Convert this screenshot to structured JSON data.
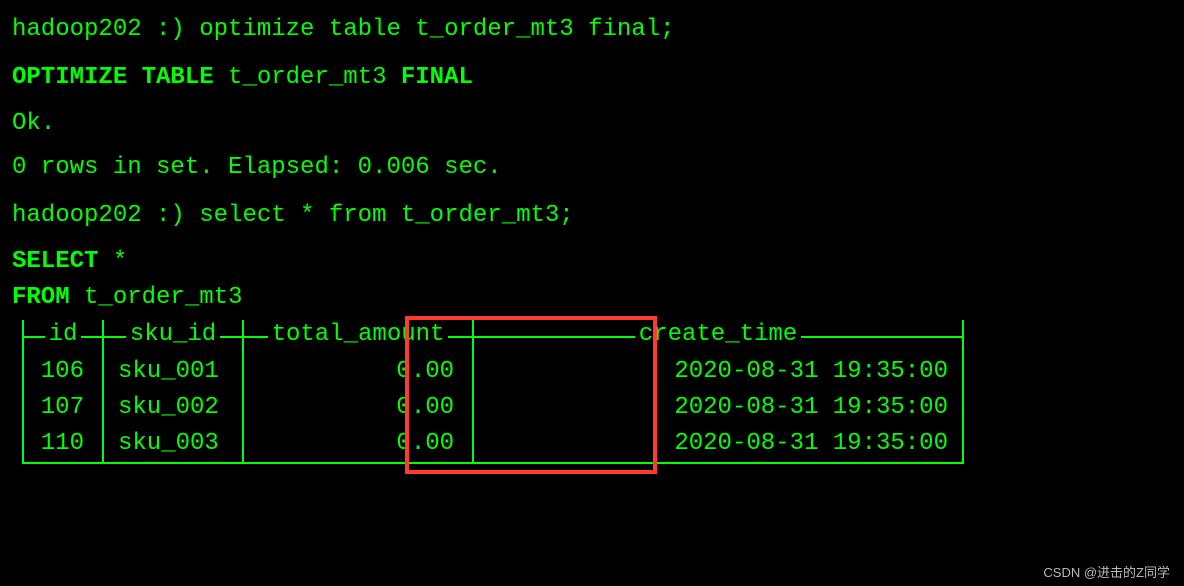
{
  "prompt1": {
    "host": "hadoop202 :)",
    "cmd": " optimize table t_order_mt3 final;"
  },
  "echo1": {
    "kw1": "OPTIMIZE TABLE",
    "tbl": " t_order_mt3 ",
    "kw2": "FINAL"
  },
  "status_ok": "Ok.",
  "elapsed": "0 rows in set. Elapsed: 0.006 sec.",
  "prompt2": {
    "host": "hadoop202 :)",
    "cmd": " select * from t_order_mt3;"
  },
  "echo2": {
    "l1_kw": "SELECT",
    "l1_rest": " *",
    "l2_kw": "FROM",
    "l2_rest": " t_order_mt3"
  },
  "table": {
    "headers": {
      "id": "id",
      "sku_id": "sku_id",
      "total_amount": "total_amount",
      "create_time": "create_time"
    },
    "rows": [
      {
        "id": "106",
        "sku_id": "sku_001",
        "total_amount": "0.00",
        "create_time": "2020-08-31 19:35:00"
      },
      {
        "id": "107",
        "sku_id": "sku_002",
        "total_amount": "0.00",
        "create_time": "2020-08-31 19:35:00"
      },
      {
        "id": "110",
        "sku_id": "sku_003",
        "total_amount": "0.00",
        "create_time": "2020-08-31 19:35:00"
      }
    ]
  },
  "watermark": "CSDN @进击的Z同学"
}
